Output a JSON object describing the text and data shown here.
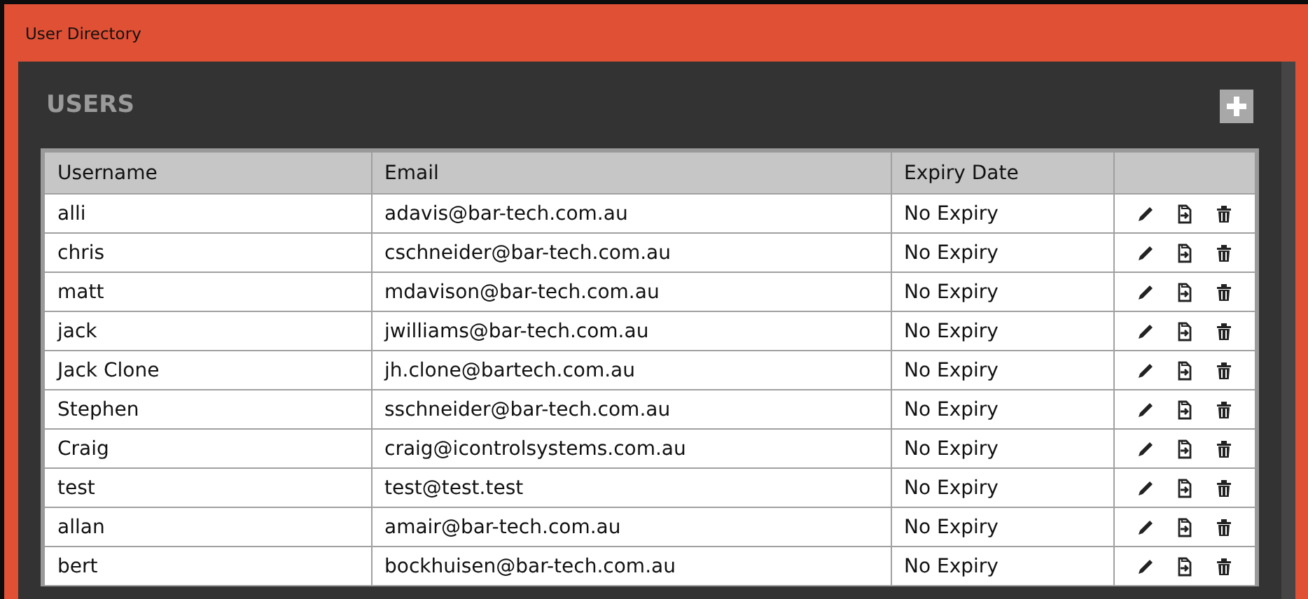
{
  "window": {
    "title": "User Directory"
  },
  "panel": {
    "title": "USERS"
  },
  "table": {
    "columns": [
      "Username",
      "Email",
      "Expiry Date"
    ],
    "rows": [
      {
        "username": "alli",
        "email": "adavis@bar-tech.com.au",
        "expiry": "No Expiry"
      },
      {
        "username": "chris",
        "email": "cschneider@bar-tech.com.au",
        "expiry": "No Expiry"
      },
      {
        "username": "matt",
        "email": "mdavison@bar-tech.com.au",
        "expiry": "No Expiry"
      },
      {
        "username": "jack",
        "email": "jwilliams@bar-tech.com.au",
        "expiry": "No Expiry"
      },
      {
        "username": "Jack Clone",
        "email": "jh.clone@bartech.com.au",
        "expiry": "No Expiry"
      },
      {
        "username": "Stephen",
        "email": "sschneider@bar-tech.com.au",
        "expiry": "No Expiry"
      },
      {
        "username": "Craig",
        "email": "craig@icontrolsystems.com.au",
        "expiry": "No Expiry"
      },
      {
        "username": "test",
        "email": "test@test.test",
        "expiry": "No Expiry"
      },
      {
        "username": "allan",
        "email": "amair@bar-tech.com.au",
        "expiry": "No Expiry"
      },
      {
        "username": "bert",
        "email": "bockhuisen@bar-tech.com.au",
        "expiry": "No Expiry"
      }
    ]
  }
}
